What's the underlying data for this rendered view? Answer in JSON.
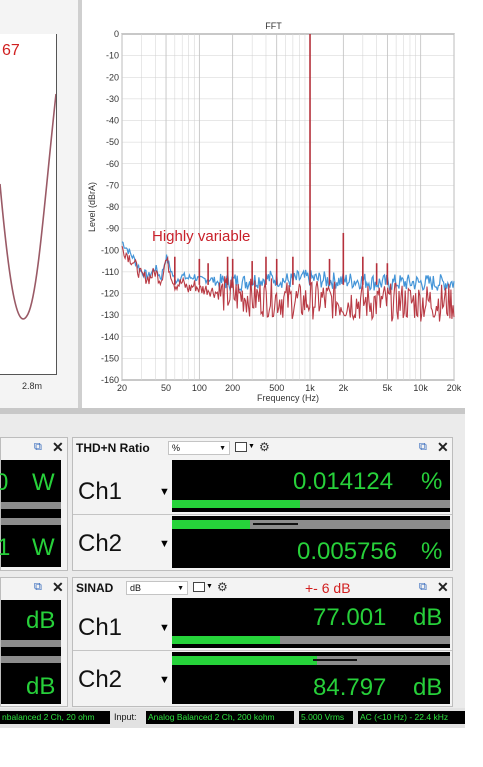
{
  "left_plot": {
    "partial_value": "67",
    "x_tick": "2.8m"
  },
  "fft": {
    "title": "FFT",
    "ylabel": "Level (dBrA)",
    "xlabel": "Frequency (Hz)",
    "annotation": "Highly variable",
    "y_ticks": [
      "0",
      "-10",
      "-20",
      "-30",
      "-40",
      "-50",
      "-60",
      "-70",
      "-80",
      "-90",
      "-100",
      "-110",
      "-120",
      "-130",
      "-140",
      "-150",
      "-160"
    ],
    "x_ticks": [
      "20",
      "50",
      "100",
      "200",
      "500",
      "1k",
      "2k",
      "5k",
      "10k",
      "20k"
    ],
    "colors": {
      "trace_blue": "#3a8fd6",
      "trace_red": "#b5303b",
      "annotation": "#c8202a"
    }
  },
  "chart_data": {
    "type": "line",
    "title": "FFT",
    "xlabel": "Frequency (Hz)",
    "ylabel": "Level (dBrA)",
    "x_scale": "log",
    "xlim": [
      20,
      20000
    ],
    "ylim": [
      -160,
      0
    ],
    "grid": true,
    "series": [
      {
        "x": [
          20,
          25,
          30,
          35,
          40,
          45,
          50,
          60,
          70,
          80,
          90,
          100,
          120,
          150,
          200,
          250,
          300,
          400,
          500,
          600,
          700,
          800,
          900,
          1000,
          1500,
          2000,
          3000,
          4000,
          5000,
          7000,
          10000,
          15000,
          20000
        ],
        "y": [
          -96,
          -103,
          -110,
          -112,
          -108,
          -113,
          -103,
          -114,
          -112,
          -113,
          -112,
          -114,
          -113,
          -115,
          -114,
          -115,
          -114,
          -113,
          -113,
          -114,
          -114,
          -113,
          -113,
          -113,
          -114,
          -114,
          -114,
          -115,
          -115,
          -115,
          -115,
          -115,
          -115
        ]
      },
      {
        "x": [
          20,
          25,
          30,
          35,
          40,
          45,
          50,
          60,
          70,
          80,
          90,
          100,
          120,
          150,
          200,
          250,
          300,
          400,
          500,
          600,
          700,
          800,
          900,
          1000,
          1500,
          2000,
          3000,
          4000,
          5000,
          7000,
          10000,
          15000,
          20000
        ],
        "y": [
          -99,
          -105,
          -112,
          -113,
          -110,
          -114,
          -104,
          -116,
          -115,
          -118,
          -116,
          -118,
          -118,
          -120,
          -121,
          -121,
          -122,
          -122,
          -122,
          -123,
          -123,
          -124,
          -124,
          -123,
          -123,
          -124,
          -124,
          -124,
          -124,
          -124,
          -124,
          -124,
          -124
        ]
      }
    ],
    "peaks": [
      {
        "x": 1000,
        "y": 0
      },
      {
        "x": 2000,
        "y": -92
      },
      {
        "x": 3000,
        "y": -103
      },
      {
        "x": 5000,
        "y": -106
      },
      {
        "x": 60,
        "y": -103
      },
      {
        "x": 100,
        "y": -104
      },
      {
        "x": 120,
        "y": -106
      },
      {
        "x": 180,
        "y": -103
      },
      {
        "x": 200,
        "y": -104
      },
      {
        "x": 300,
        "y": -105
      },
      {
        "x": 400,
        "y": -103
      },
      {
        "x": 500,
        "y": -104
      },
      {
        "x": 700,
        "y": -103
      },
      {
        "x": 1500,
        "y": -104
      },
      {
        "x": 4000,
        "y": -106
      }
    ],
    "annotation": "Highly variable"
  },
  "meters": {
    "left_top": {
      "value_partial": "0",
      "unit": "W",
      "value2_partial": "1",
      "unit2": "W"
    },
    "left_bottom": {
      "unit": "dB",
      "unit2": "dB"
    },
    "thd": {
      "title": "THD+N Ratio",
      "unit_select": "%",
      "rows": [
        {
          "label": "Ch1",
          "value": "0.014124",
          "unit": "%",
          "fill": 0.46,
          "peak": 0.0
        },
        {
          "label": "Ch2",
          "value": "0.005756",
          "unit": "%",
          "fill": 0.28,
          "peak": 0.45
        }
      ]
    },
    "sinad": {
      "title": "SINAD",
      "unit_select": "dB",
      "annotation": "+- 6 dB",
      "rows": [
        {
          "label": "Ch1",
          "value": "77.001",
          "unit": "dB",
          "fill": 0.39,
          "peak": 0.0
        },
        {
          "label": "Ch2",
          "value": "84.797",
          "unit": "dB",
          "fill": 0.52,
          "peak": 0.67
        }
      ]
    }
  },
  "statusbar": {
    "output_partial": "nbalanced 2 Ch, 20 ohm",
    "input_label": "Input:",
    "input_value": "Analog Balanced 2 Ch, 200 kohm",
    "level": "5.000 Vrms",
    "filter": "AC (<10 Hz) - 22.4 kHz"
  }
}
